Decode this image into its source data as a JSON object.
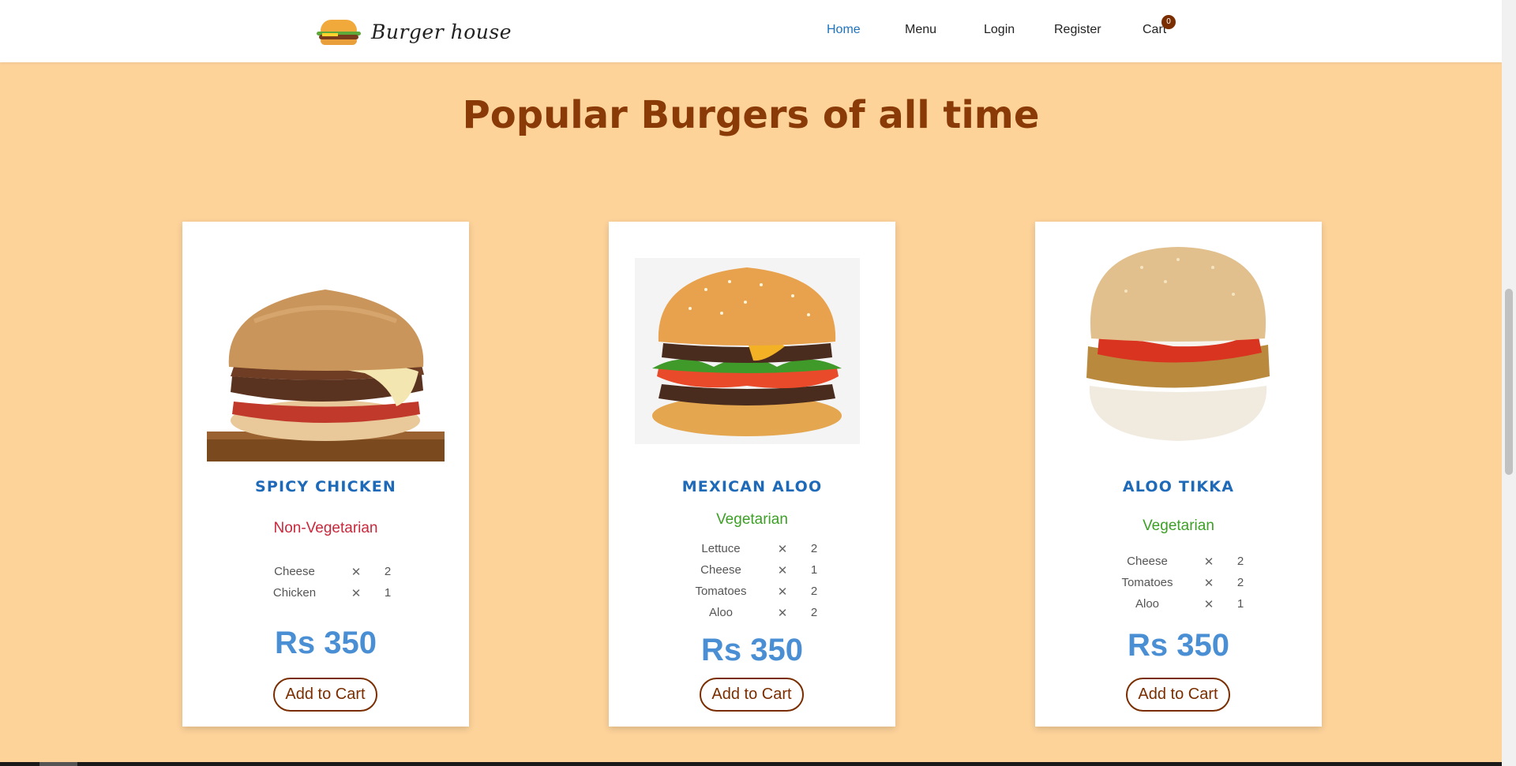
{
  "header": {
    "brand": "Burger house",
    "nav": [
      {
        "label": "Home",
        "active": true
      },
      {
        "label": "Menu"
      },
      {
        "label": "Login"
      },
      {
        "label": "Register"
      },
      {
        "label": "Cart"
      }
    ],
    "cart_count": "0"
  },
  "section": {
    "title": "Popular Burgers of all time"
  },
  "products": [
    {
      "name": "SPICY CHICKEN",
      "type": "Non-Vegetarian",
      "ingredients": [
        {
          "name": "Cheese",
          "x": "✕",
          "qty": "2"
        },
        {
          "name": "Chicken",
          "x": "✕",
          "qty": "1"
        }
      ],
      "price": "Rs 350",
      "button": "Add to Cart"
    },
    {
      "name": "MEXICAN ALOO",
      "type": "Vegetarian",
      "ingredients": [
        {
          "name": "Lettuce",
          "x": "✕",
          "qty": "2"
        },
        {
          "name": "Cheese",
          "x": "✕",
          "qty": "1"
        },
        {
          "name": "Tomatoes",
          "x": "✕",
          "qty": "2"
        },
        {
          "name": "Aloo",
          "x": "✕",
          "qty": "2"
        }
      ],
      "price": "Rs 350",
      "button": "Add to Cart"
    },
    {
      "name": "ALOO TIKKA",
      "type": "Vegetarian",
      "ingredients": [
        {
          "name": "Cheese",
          "x": "✕",
          "qty": "2"
        },
        {
          "name": "Tomatoes",
          "x": "✕",
          "qty": "2"
        },
        {
          "name": "Aloo",
          "x": "✕",
          "qty": "1"
        }
      ],
      "price": "Rs 350",
      "button": "Add to Cart"
    }
  ],
  "colors": {
    "page_bg": "#fdd39a",
    "title": "#8a3a06",
    "name": "#1e6ab8",
    "nonveg": "#c8283c",
    "veg": "#3d9f26",
    "price": "#4a8fd4",
    "accent": "#7a2e00"
  }
}
